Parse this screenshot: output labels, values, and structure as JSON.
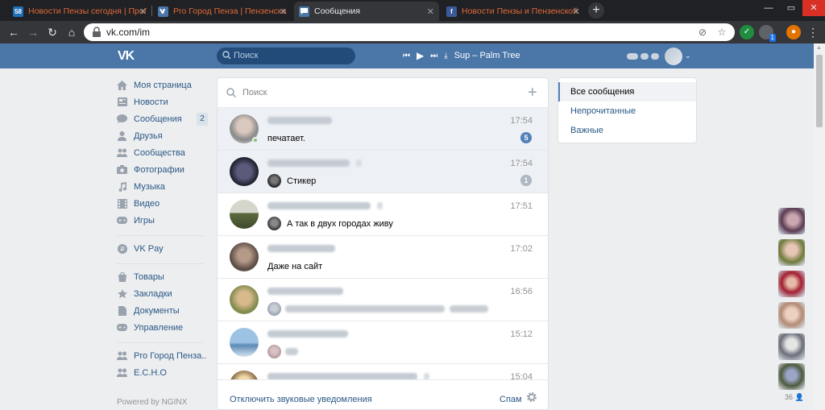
{
  "browser": {
    "tabs": [
      {
        "title": "Новости Пензы сегодня | ПроГ",
        "favicon": "58",
        "active": false
      },
      {
        "title": "Pro Город Пенза | Пензенская с",
        "favicon": "vk",
        "active": false
      },
      {
        "title": "Сообщения",
        "favicon": "chat",
        "active": true
      },
      {
        "title": "Новости Пензы и Пензенской с",
        "favicon": "fb",
        "active": false
      }
    ],
    "url": "vk.com/im",
    "extension_badge": "1"
  },
  "header": {
    "logo": "VK",
    "search_placeholder": "Поиск",
    "now_playing": "Sup – Palm Tree"
  },
  "sidebar": {
    "items": [
      {
        "label": "Моя страница",
        "icon": "home-icon"
      },
      {
        "label": "Новости",
        "icon": "news-icon"
      },
      {
        "label": "Сообщения",
        "icon": "messages-icon",
        "badge": "2"
      },
      {
        "label": "Друзья",
        "icon": "friends-icon"
      },
      {
        "label": "Сообщества",
        "icon": "communities-icon"
      },
      {
        "label": "Фотографии",
        "icon": "camera-icon"
      },
      {
        "label": "Музыка",
        "icon": "music-icon"
      },
      {
        "label": "Видео",
        "icon": "video-icon"
      },
      {
        "label": "Игры",
        "icon": "games-icon"
      },
      {
        "label": "VK Pay",
        "icon": "vkpay-icon"
      },
      {
        "label": "Товары",
        "icon": "goods-icon"
      },
      {
        "label": "Закладки",
        "icon": "star-icon"
      },
      {
        "label": "Документы",
        "icon": "document-icon"
      },
      {
        "label": "Управление",
        "icon": "gamepad-icon"
      },
      {
        "label": "Pro Город Пенза..",
        "icon": "group-icon"
      },
      {
        "label": "E.C.H.O",
        "icon": "group-icon"
      }
    ],
    "powered_by": "Powered by NGINX"
  },
  "dialogs": {
    "search_placeholder": "Поиск",
    "rows": [
      {
        "time": "17:54",
        "message": "печатает.",
        "unread": "5",
        "unread_color": "#5181b8",
        "highlight": true,
        "online": true
      },
      {
        "time": "17:54",
        "message": "Стикер",
        "unread": "1",
        "unread_color": "#aeb7c2",
        "highlight": true,
        "online": false
      },
      {
        "time": "17:51",
        "message": "А так в двух городах живу",
        "unread": "",
        "highlight": false,
        "online": false
      },
      {
        "time": "17:02",
        "message": "Даже на сайт",
        "unread": "",
        "highlight": false,
        "online": false
      },
      {
        "time": "16:56",
        "message": "",
        "unread": "",
        "highlight": false,
        "online": false
      },
      {
        "time": "15:12",
        "message": "",
        "unread": "",
        "highlight": false,
        "online": false
      },
      {
        "time": "15:04",
        "message": "",
        "unread": "",
        "highlight": false,
        "online": false
      }
    ],
    "footer": {
      "mute_label": "Отключить звуковые уведомления",
      "spam_label": "Спам"
    }
  },
  "filters": {
    "items": [
      "Все сообщения",
      "Непрочитанные",
      "Важные"
    ],
    "selected": "Все сообщения"
  },
  "friends_online": {
    "count": "36"
  }
}
